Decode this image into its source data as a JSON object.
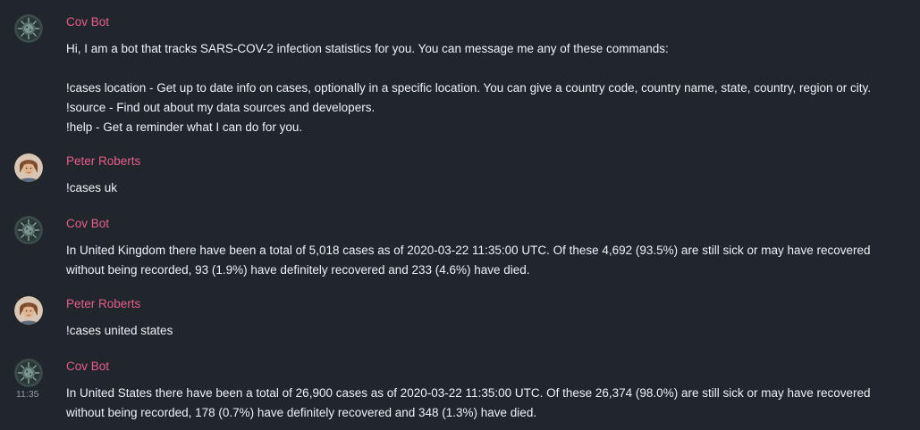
{
  "messages": [
    {
      "sender": "Cov Bot",
      "avatar": "virus-icon",
      "lines": [
        "Hi, I am a bot that tracks SARS-COV-2 infection statistics for you. You can message me any of these commands:",
        "",
        "!cases location - Get up to date info on cases, optionally in a specific location. You can give a country code, country name, state, country, region or city.",
        "!source - Find out about my data sources and developers.",
        "!help - Get a reminder what I can do for you."
      ]
    },
    {
      "sender": "Peter Roberts",
      "avatar": "user-avatar",
      "lines": [
        "!cases uk"
      ]
    },
    {
      "sender": "Cov Bot",
      "avatar": "virus-icon",
      "lines": [
        "In United Kingdom there have been a total of 5,018 cases as of 2020-03-22 11:35:00 UTC. Of these 4,692 (93.5%) are still sick or may have recovered without being recorded, 93 (1.9%) have definitely recovered and 233 (4.6%) have died."
      ]
    },
    {
      "sender": "Peter Roberts",
      "avatar": "user-avatar",
      "lines": [
        "!cases united states"
      ]
    },
    {
      "sender": "Cov Bot",
      "avatar": "virus-icon",
      "timestamp": "11:35",
      "lines": [
        "In United States there have been a total of 26,900 cases as of 2020-03-22 11:35:00 UTC. Of these 26,374 (98.0%) are still sick or may have recovered without being recorded, 178 (0.7%) have definitely recovered and 348 (1.3%) have died."
      ]
    }
  ]
}
